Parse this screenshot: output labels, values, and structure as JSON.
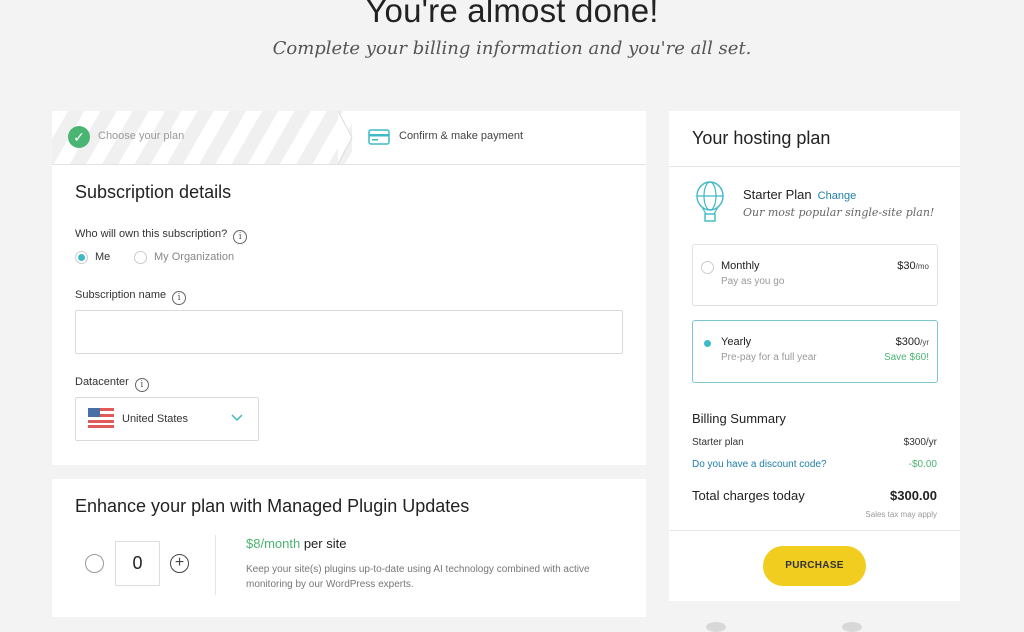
{
  "page": {
    "title": "You're almost done!",
    "subtitle": "Complete your billing information and you're all set."
  },
  "steps": {
    "step1": "Choose your plan",
    "step2": "Confirm & make payment"
  },
  "subscription": {
    "title": "Subscription details",
    "owner_label": "Who will own this subscription?",
    "owner_options": [
      "Me",
      "My Organization"
    ],
    "owner_selected": "Me",
    "name_label": "Subscription name",
    "name_value": "",
    "datacenter_label": "Datacenter",
    "datacenter_value": "United States"
  },
  "enhance": {
    "title": "Enhance your plan with Managed Plugin Updates",
    "quantity": "0",
    "price": "$8/month",
    "price_suffix": "per site",
    "description": "Keep your site(s) plugins up-to-date using AI technology combined with active monitoring by our WordPress experts."
  },
  "hosting": {
    "title": "Your hosting plan",
    "plan_name": "Starter Plan",
    "change_link": "Change",
    "plan_tagline": "Our most popular single-site plan!",
    "options": [
      {
        "name": "Monthly",
        "detail": "Pay as you go",
        "price": "$30",
        "unit": "/mo",
        "selected": false
      },
      {
        "name": "Yearly",
        "detail": "Pre-pay for a full year",
        "price": "$300",
        "unit": "/yr",
        "savings": "Save $60!",
        "selected": true
      }
    ],
    "billing_summary": {
      "title": "Billing Summary",
      "plan_label": "Starter plan",
      "plan_amount": "$300/yr",
      "discount_label": "Do you have a discount code?",
      "discount_amount": "-$0.00",
      "total_label": "Total charges today",
      "total_amount": "$300.00",
      "tax_note": "Sales tax may apply"
    },
    "purchase_label": "PURCHASE"
  },
  "colors": {
    "accent": "#3fb9c6",
    "success": "#4ab472",
    "link": "#1e7fa8",
    "purchase": "#f0cd1e"
  },
  "icons": {
    "step1": "check-icon",
    "step2": "credit-card-icon",
    "plan": "hot-air-balloon-icon",
    "datacenter": "us-flag-icon"
  }
}
